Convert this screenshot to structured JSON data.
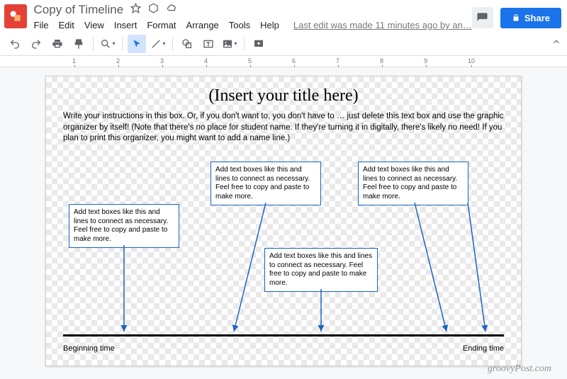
{
  "header": {
    "doc_title": "Copy of Timeline",
    "last_edit": "Last edit was made 11 minutes ago by an…",
    "share_label": "Share"
  },
  "menu": {
    "file": "File",
    "edit": "Edit",
    "view": "View",
    "insert": "Insert",
    "format": "Format",
    "arrange": "Arrange",
    "tools": "Tools",
    "help": "Help"
  },
  "ruler": {
    "ticks": [
      "1",
      "2",
      "3",
      "4",
      "5",
      "6",
      "7",
      "8",
      "9",
      "10"
    ]
  },
  "slide": {
    "title": "(Insert your title here)",
    "instructions": "Write your instructions in this box. Or, if you don't want to, you don't have to … just delete this text box and use the graphic organizer by itself! (Note that there's no place for student name. If they're turning it in digitally, there's likely no need! If you plan to print this organizer, you might want to add a name line.)",
    "note_text": "Add text boxes like this and lines to connect as necessary. Feel free to copy and paste to make more.",
    "beginning_label": "Beginning time",
    "ending_label": "Ending time"
  },
  "watermark": "groovyPost.com"
}
